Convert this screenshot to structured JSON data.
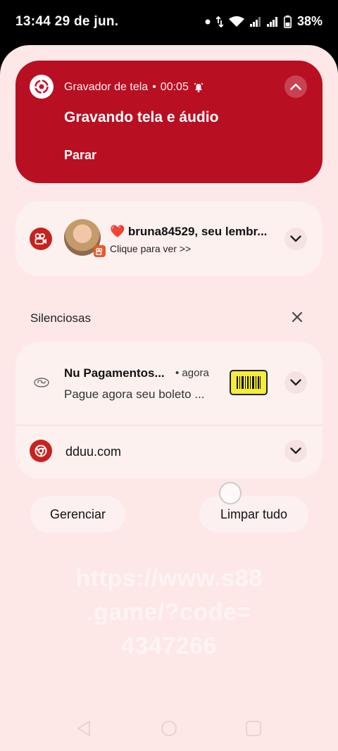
{
  "status_bar": {
    "time": "13:44",
    "date": "29 de jun.",
    "battery": "38%"
  },
  "recorder_card": {
    "app_name": "Gravador de tela",
    "separator": "•",
    "elapsed": "00:05",
    "title": "Gravando tela e áudio",
    "action": "Parar",
    "color": "#b90f22"
  },
  "kwai_notification": {
    "heart": "❤️",
    "title": "bruna84529, seu lembr...",
    "subtitle": "Clique para ver >>"
  },
  "silent_section": {
    "label": "Silenciosas"
  },
  "nu_notification": {
    "title": "Nu Pagamentos...",
    "time": "• agora",
    "body": "Pague agora seu boleto ..."
  },
  "chrome_notification": {
    "label": "dduu.com"
  },
  "footer_buttons": {
    "manage": "Gerenciar",
    "clear_all": "Limpar tudo"
  },
  "watermark": {
    "line1": "https://www.s88",
    "line2": ".game/?code=",
    "line3": "4347266"
  }
}
